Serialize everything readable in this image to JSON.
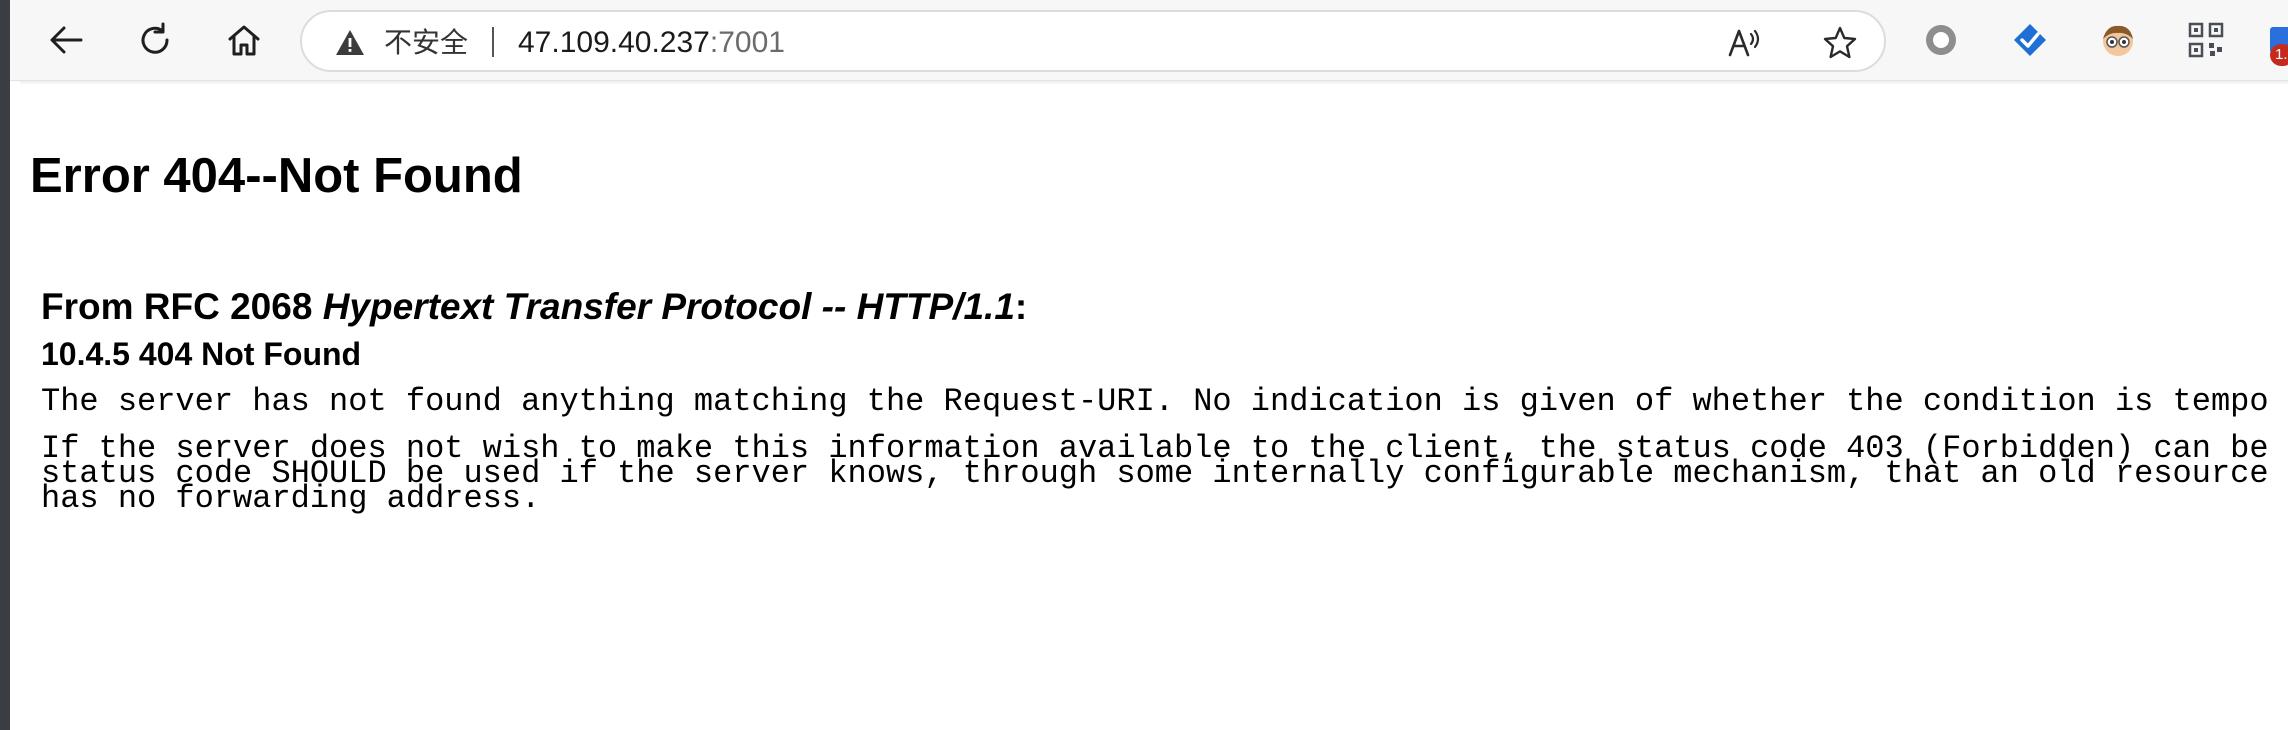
{
  "browser": {
    "security_label": "不安全",
    "url_host": "47.109.40.237",
    "url_port": ":7001",
    "badge_count": "1.",
    "icons": {
      "back": "back-arrow-icon",
      "refresh": "refresh-icon",
      "home": "home-icon",
      "warning": "warning-icon",
      "read_aloud": "read-aloud-icon",
      "favorite": "star-icon",
      "extensions": [
        "circle-extension-icon",
        "checkmark-extension-icon",
        "avatar-extension-icon",
        "qr-code-extension-icon",
        "blue-extension-icon"
      ]
    }
  },
  "page": {
    "title": "Error 404--Not Found",
    "rfc_prefix": "From RFC 2068 ",
    "rfc_title": "Hypertext Transfer Protocol -- HTTP/1.1",
    "rfc_suffix": ":",
    "section": "10.4.5 404 Not Found",
    "para1": "The server has not found anything matching the Request-URI. No indication is given of whether the condition is tempo",
    "para2_line1": "If the server does not wish to make this information available to the client, the status code 403 (Forbidden) can be",
    "para2_line2": "status code SHOULD be used if the server knows, through some internally configurable mechanism, that an old resource",
    "para2_line3": "has no forwarding address."
  },
  "colors": {
    "toolbar_bg": "#f7f7f7",
    "badge": "#c42b1c",
    "edge": "#3a3d42"
  }
}
